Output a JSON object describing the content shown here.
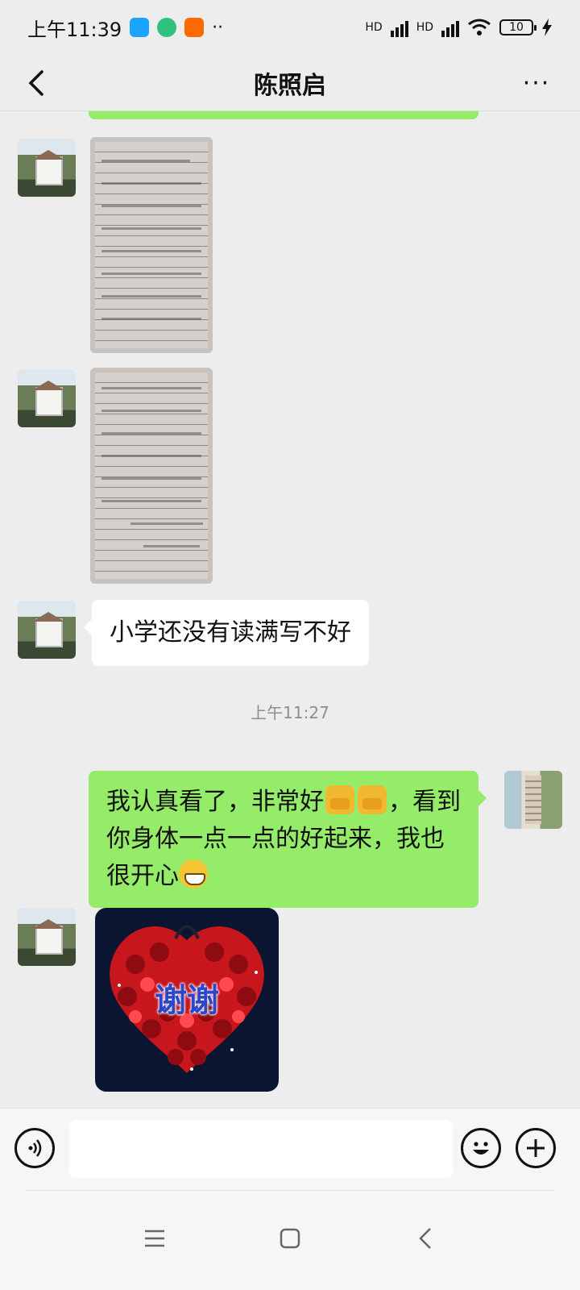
{
  "status_bar": {
    "time": "上午11:39",
    "hd1": "HD",
    "hd2": "HD",
    "battery": "10",
    "more_dots": "··"
  },
  "header": {
    "title": "陈照启",
    "more_label": "···"
  },
  "messages": {
    "incoming_text": "小学还没有读满写不好",
    "timestamp": "上午11:27",
    "outgoing_text_1": "我认真看了，非常好",
    "outgoing_text_2": "，看到你身体一点一点的好起来，我也很开心",
    "sticker_text": "谢谢"
  },
  "colors": {
    "bubble_out": "#95ec69",
    "bubble_in": "#ffffff",
    "background": "#ededed",
    "status_app_1": "#1aa3ff",
    "status_app_2": "#2ec27e",
    "status_app_3": "#ff6a00"
  },
  "icons": {
    "back": "chevron-left-icon",
    "more": "more-dots-icon",
    "voice": "voice-icon",
    "emoji": "emoji-icon",
    "plus": "plus-icon",
    "nav_menu": "menu-icon",
    "nav_home": "home-square-icon",
    "nav_back": "nav-back-icon"
  }
}
